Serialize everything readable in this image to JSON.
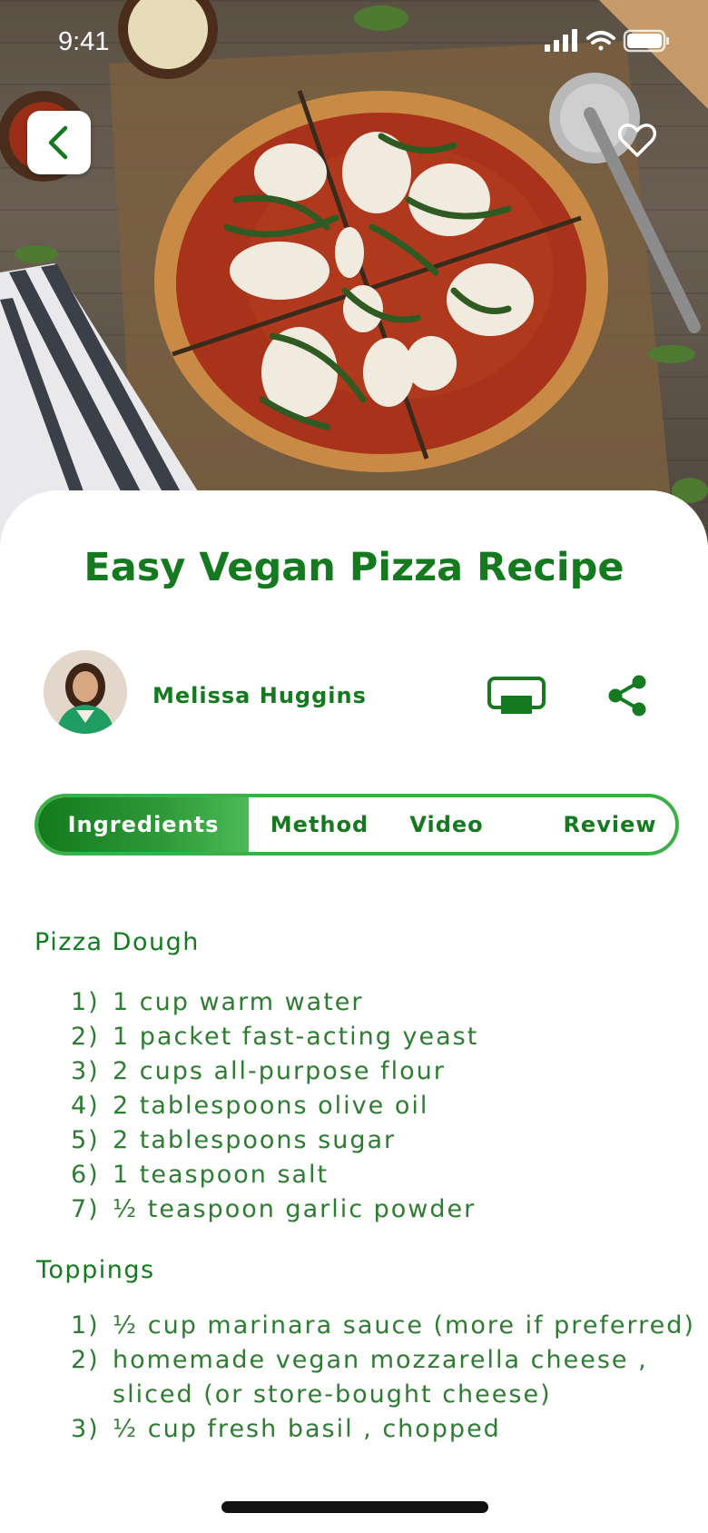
{
  "status_bar": {
    "time": "9:41"
  },
  "hero": {
    "image": "vegan-pizza-photo",
    "back_icon": "chevron-left-icon",
    "favorite_icon": "heart-outline-icon"
  },
  "recipe": {
    "title": "Easy Vegan Pizza Recipe",
    "author": {
      "name": "Melissa Huggins",
      "avatar": "author-avatar-photo"
    },
    "actions": {
      "cast_icon": "cast-screen-icon",
      "share_icon": "share-icon"
    }
  },
  "tabs": [
    {
      "label": "Ingredients",
      "active": true
    },
    {
      "label": "Method",
      "active": false
    },
    {
      "label": "Video",
      "active": false
    },
    {
      "label": "Review",
      "active": false
    }
  ],
  "sections": [
    {
      "heading": "Pizza Dough",
      "items": [
        {
          "num": "1)",
          "text": "1 cup warm water"
        },
        {
          "num": "2)",
          "text": "1 packet fast-acting yeast"
        },
        {
          "num": "3)",
          "text": "2 cups all-purpose flour"
        },
        {
          "num": "4)",
          "text": "2 tablespoons olive oil"
        },
        {
          "num": "5)",
          "text": "2 tablespoons sugar"
        },
        {
          "num": "6)",
          "text": "1 teaspoon salt"
        },
        {
          "num": "7)",
          "text": "½ teaspoon garlic powder"
        }
      ]
    },
    {
      "heading": "Toppings",
      "items": [
        {
          "num": "1)",
          "text": "½ cup marinara sauce (more if preferred)"
        },
        {
          "num": "2)",
          "text": "homemade vegan mozzarella cheese ,",
          "text2": "sliced (or store-bought cheese)"
        },
        {
          "num": "3)",
          "text": "½ cup fresh basil , chopped"
        }
      ]
    }
  ],
  "colors": {
    "accent": "#157a1f",
    "accent_light": "#3daf48",
    "text": "#2e7c32"
  }
}
